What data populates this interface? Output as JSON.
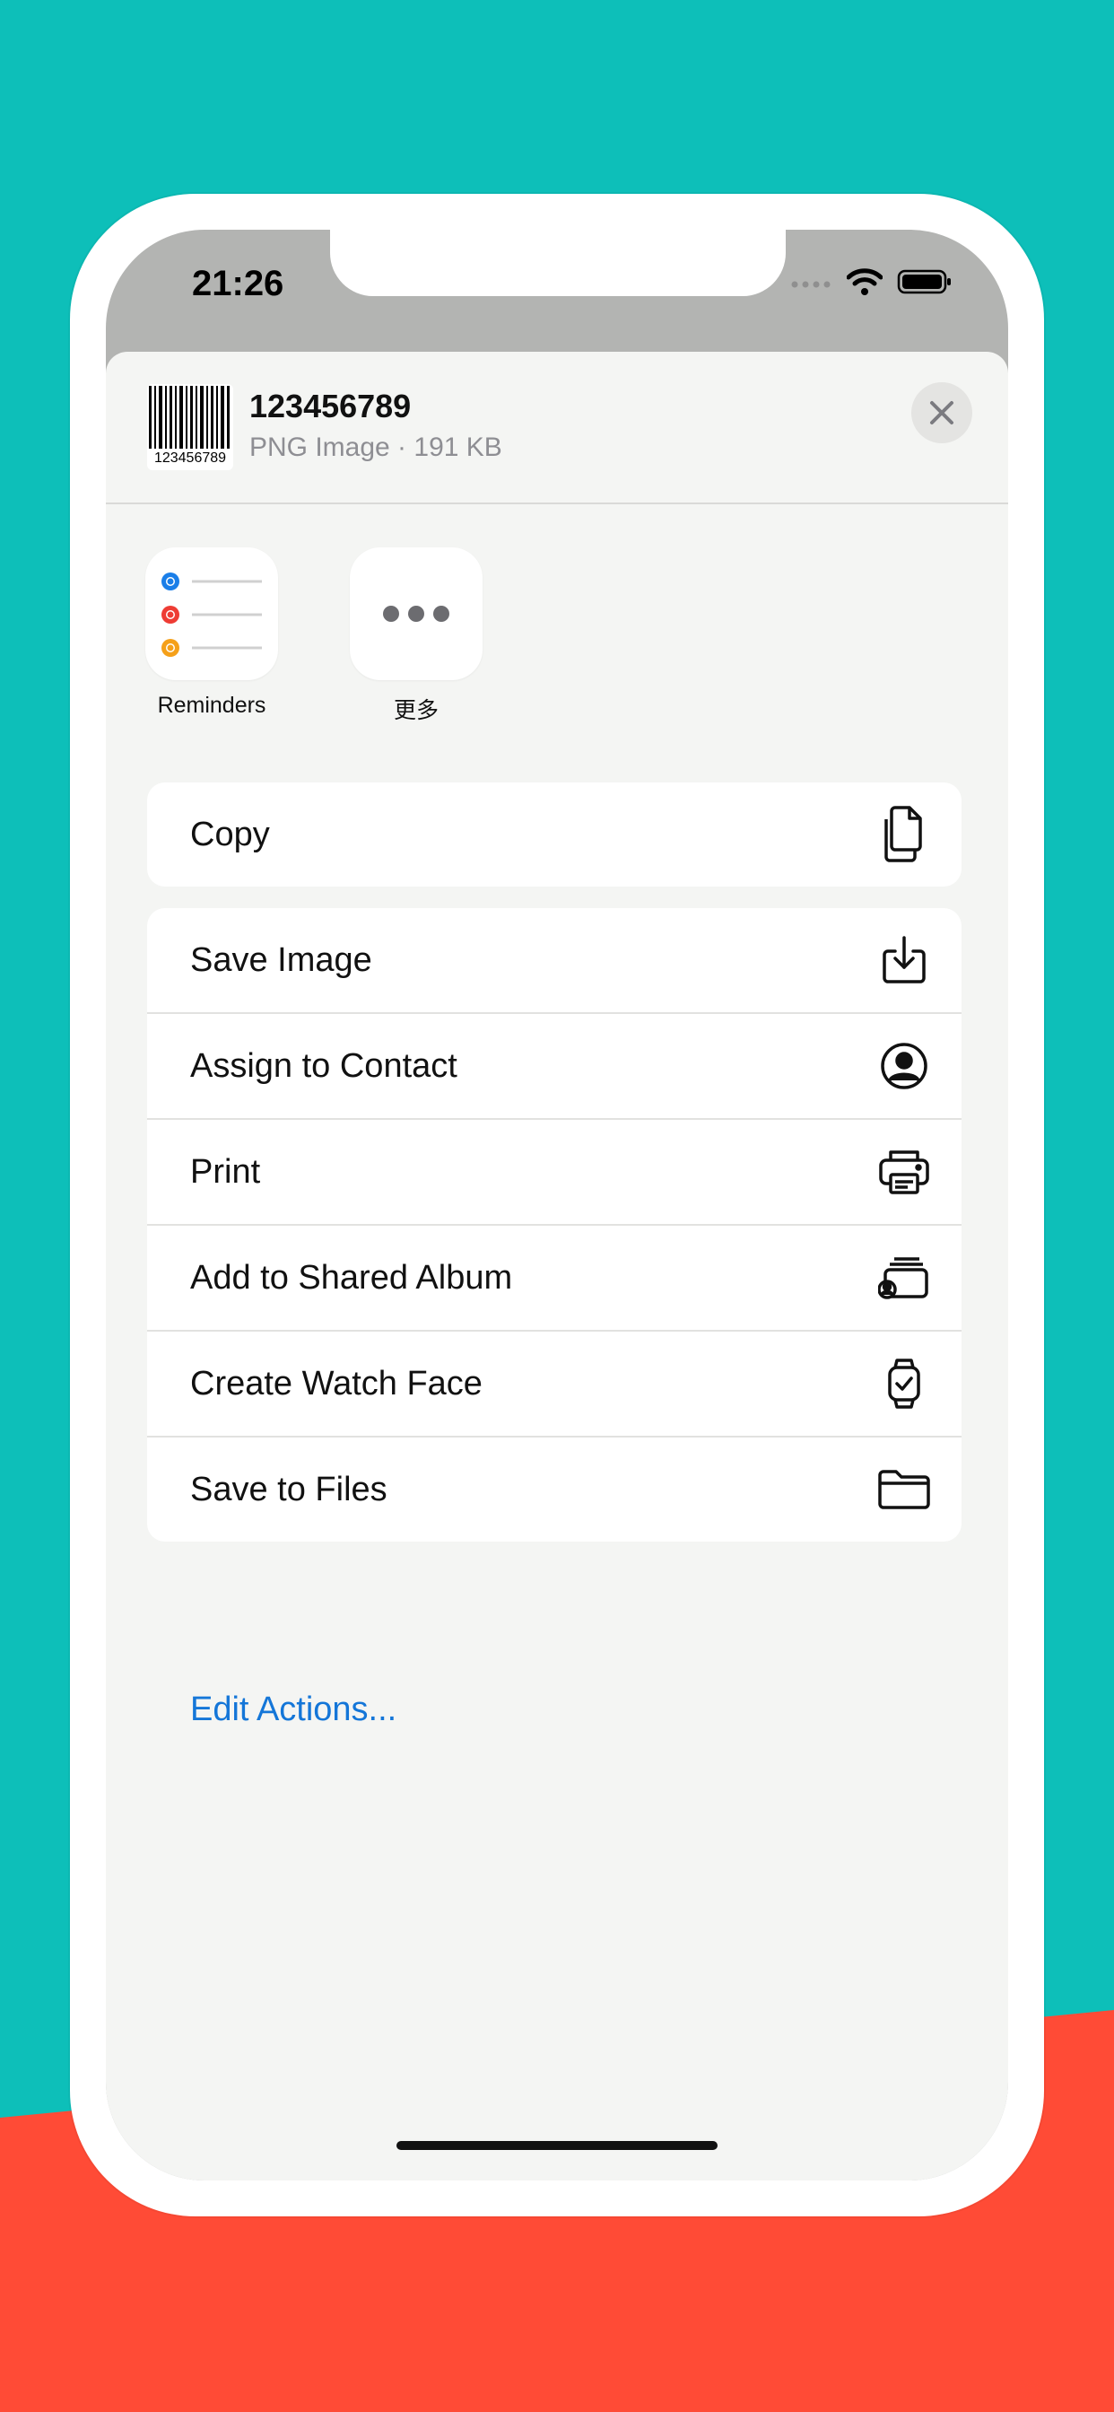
{
  "status_bar": {
    "time": "21:26"
  },
  "share_sheet": {
    "file_title": "123456789",
    "file_subtitle": "PNG Image · 191 KB",
    "thumbnail_caption": "123456789",
    "apps": [
      {
        "label": "Reminders",
        "icon": "reminders-icon"
      },
      {
        "label": "更多",
        "icon": "more-icon"
      }
    ],
    "copy_group": [
      {
        "label": "Copy",
        "icon": "copy-icon"
      }
    ],
    "actions": [
      {
        "label": "Save Image",
        "icon": "save-image-icon"
      },
      {
        "label": "Assign to Contact",
        "icon": "contact-icon"
      },
      {
        "label": "Print",
        "icon": "printer-icon"
      },
      {
        "label": "Add to Shared Album",
        "icon": "shared-album-icon"
      },
      {
        "label": "Create Watch Face",
        "icon": "watch-icon"
      },
      {
        "label": "Save to Files",
        "icon": "folder-icon"
      }
    ],
    "edit_actions": "Edit Actions..."
  },
  "colors": {
    "background_top": "#0dbfb9",
    "background_bottom": "#ff4b36",
    "link": "#1476d8",
    "reminder_blue": "#1a7ee8",
    "reminder_red": "#ee3c34",
    "reminder_orange": "#f5a019"
  }
}
